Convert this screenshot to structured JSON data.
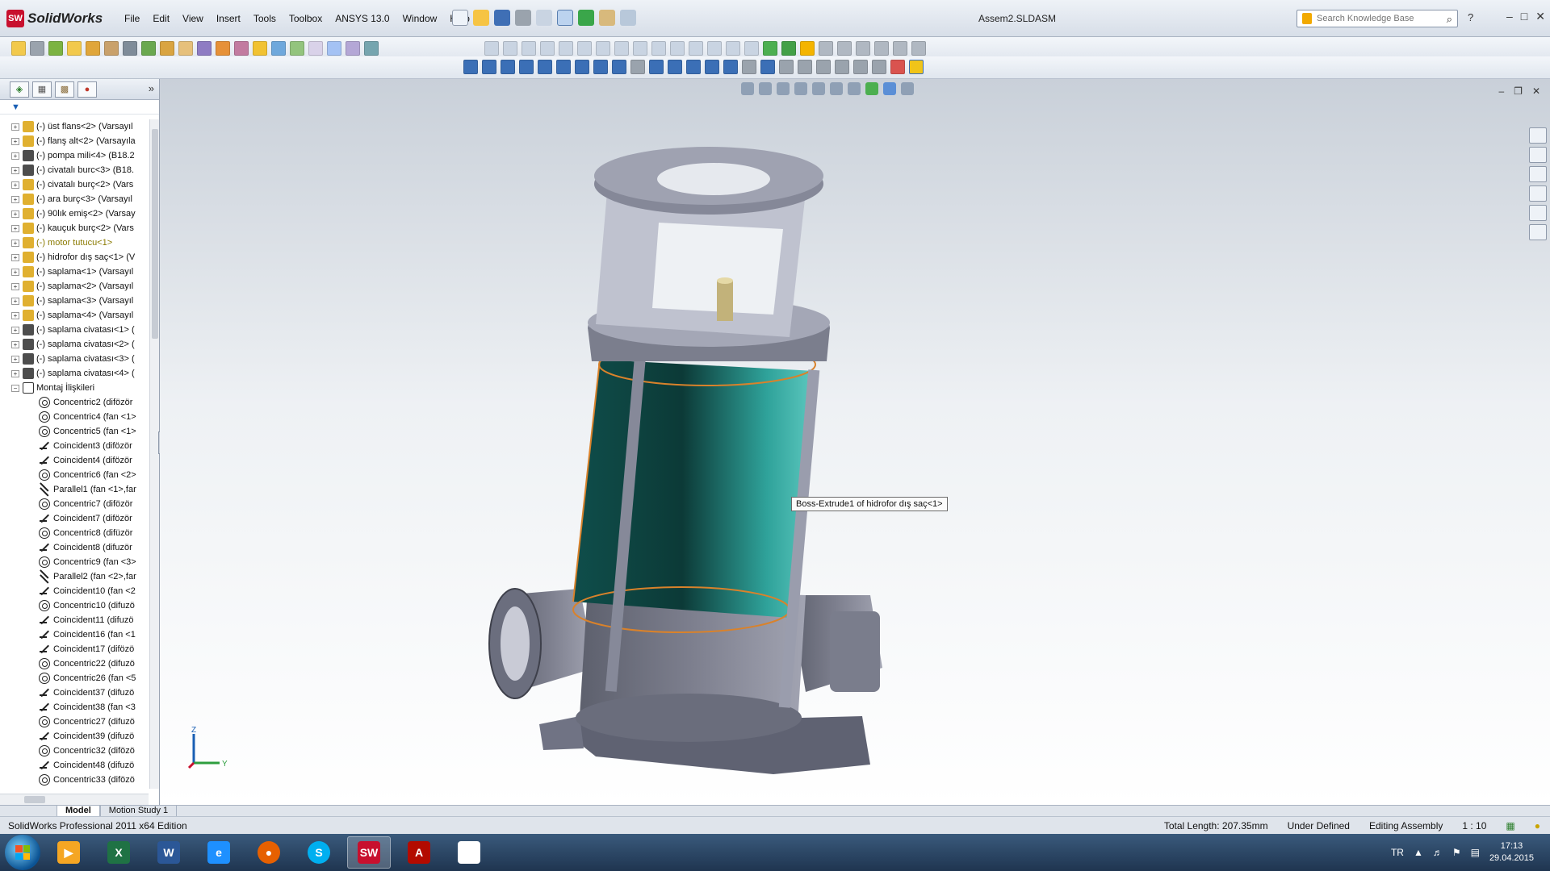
{
  "app": {
    "logo_text": "SolidWorks",
    "doc_title": "Assem2.SLDASM"
  },
  "menu": {
    "items": [
      "File",
      "Edit",
      "View",
      "Insert",
      "Tools",
      "Toolbox",
      "ANSYS 13.0",
      "Window",
      "Help"
    ]
  },
  "search": {
    "placeholder": "Search Knowledge Base"
  },
  "feature_tree": {
    "components": [
      {
        "label": "(-) üst flans<2> (Varsayıl"
      },
      {
        "label": "(-) flanş alt<2> (Varsayıla"
      },
      {
        "label": "(-) pompa mili<4> (B18.2"
      },
      {
        "label": "(-) civatalı burc<3> (B18."
      },
      {
        "label": "(-) civatalı burç<2> (Vars"
      },
      {
        "label": "(-) ara burç<3> (Varsayıl"
      },
      {
        "label": "(-) 90lık emiş<2> (Varsay"
      },
      {
        "label": "(-) kauçuk burç<2> (Vars"
      },
      {
        "label": "(-) motor tutucu<1>"
      },
      {
        "label": "(-) hidrofor dış saç<1> (V"
      },
      {
        "label": "(-) saplama<1> (Varsayıl"
      },
      {
        "label": "(-) saplama<2> (Varsayıl"
      },
      {
        "label": "(-) saplama<3> (Varsayıl"
      },
      {
        "label": "(-) saplama<4> (Varsayıl"
      },
      {
        "label": "(-) saplama civatası<1> ("
      },
      {
        "label": "(-) saplama civatası<2> ("
      },
      {
        "label": "(-) saplama civatası<3> ("
      },
      {
        "label": "(-) saplama civatası<4> ("
      }
    ],
    "mates_folder": "Montaj İlişkileri",
    "mates": [
      {
        "label": "Concentric2 (difözör"
      },
      {
        "label": "Concentric4 (fan <1>"
      },
      {
        "label": "Concentric5 (fan <1>"
      },
      {
        "label": "Coincident3 (difözör"
      },
      {
        "label": "Coincident4 (difözör"
      },
      {
        "label": "Concentric6 (fan <2>"
      },
      {
        "label": "Parallel1 (fan <1>,far"
      },
      {
        "label": "Concentric7 (difözör"
      },
      {
        "label": "Coincident7 (difözör"
      },
      {
        "label": "Concentric8 (difüzör"
      },
      {
        "label": "Coincident8 (difuzör"
      },
      {
        "label": "Concentric9 (fan <3>"
      },
      {
        "label": "Parallel2 (fan <2>,far"
      },
      {
        "label": "Coincident10 (fan <2"
      },
      {
        "label": "Concentric10 (difuzö"
      },
      {
        "label": "Coincident11 (difuzö"
      },
      {
        "label": "Coincident16 (fan <1"
      },
      {
        "label": "Coincident17 (difözö"
      },
      {
        "label": "Concentric22 (difuzö"
      },
      {
        "label": "Concentric26 (fan <5"
      },
      {
        "label": "Coincident37 (difuzö"
      },
      {
        "label": "Coincident38 (fan <3"
      },
      {
        "label": "Concentric27 (difuzö"
      },
      {
        "label": "Coincident39 (difuzö"
      },
      {
        "label": "Concentric32 (difözö"
      },
      {
        "label": "Coincident48 (difuzö"
      },
      {
        "label": "Concentric33 (difözö"
      }
    ]
  },
  "viewport": {
    "tooltip": "Boss-Extrude1 of hidrofor dış saç<1>",
    "triad_z": "Z",
    "triad_y": "Y"
  },
  "bottom_tabs": {
    "model": "Model",
    "motion": "Motion Study 1"
  },
  "status": {
    "edition": "SolidWorks Professional 2011 x64 Edition",
    "total_length": "Total Length: 207.35mm",
    "definition": "Under Defined",
    "mode": "Editing Assembly",
    "scale": "1 : 10"
  },
  "taskbar": {
    "language": "TR",
    "time": "17:13",
    "date": "29.04.2015"
  },
  "colors": {
    "accent": "#c8102e",
    "tank_teal": "#1c8c86",
    "body_gray": "#7d7f8e"
  }
}
